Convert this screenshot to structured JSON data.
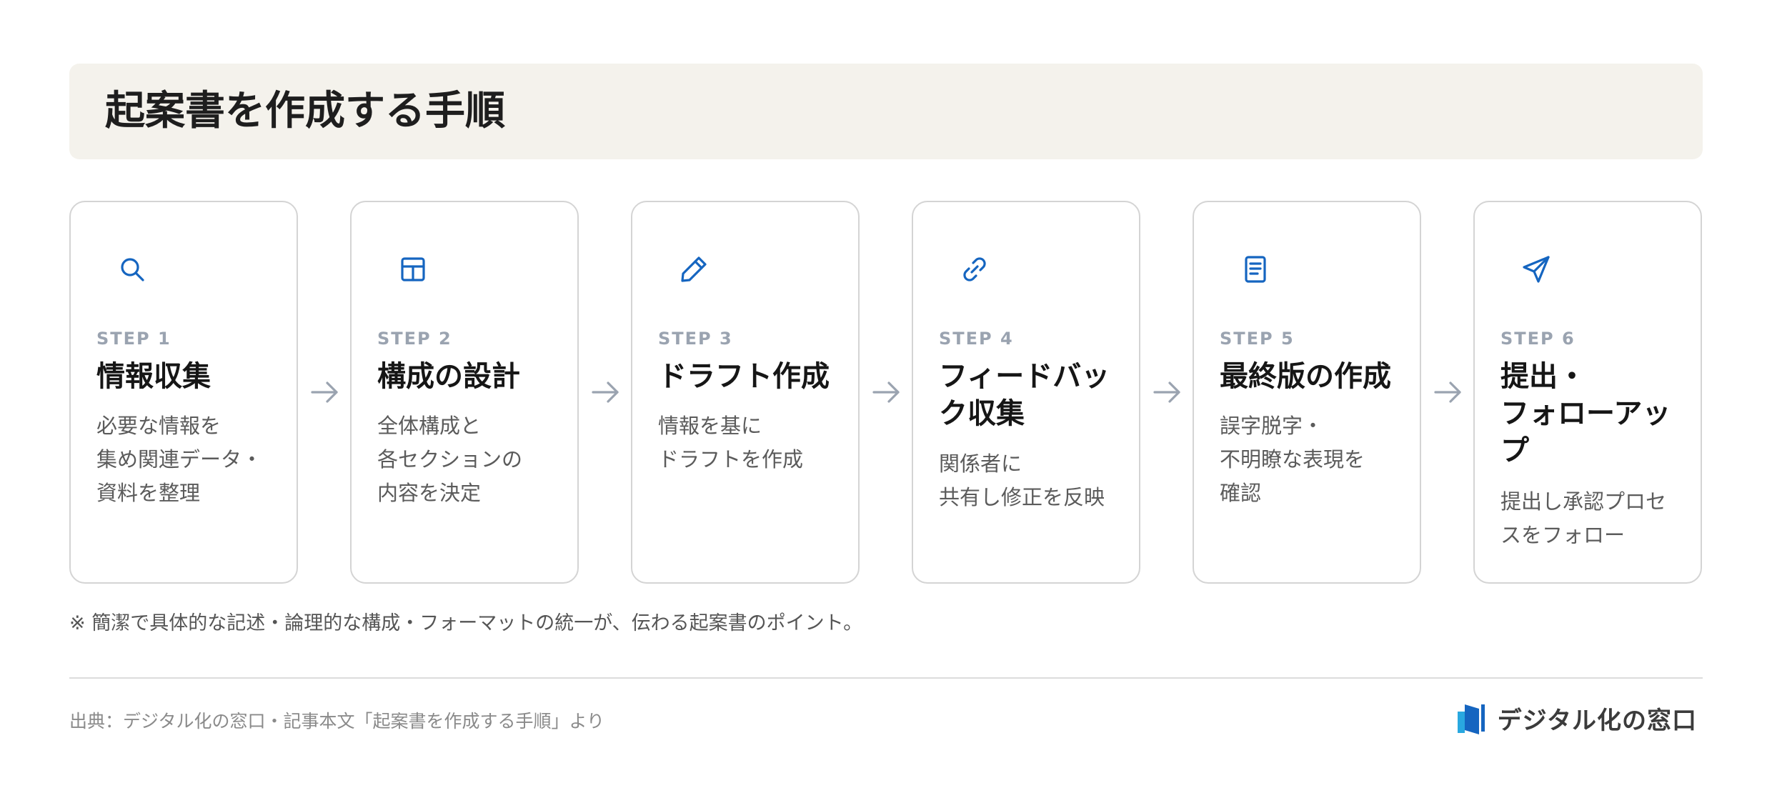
{
  "title": "起案書を作成する手順",
  "steps": [
    {
      "label": "STEP 1",
      "title": "情報収集",
      "desc": "必要な情報を\n集め関連データ・\n資料を整理",
      "icon": "search-icon"
    },
    {
      "label": "STEP 2",
      "title": "構成の設計",
      "desc": "全体構成と\n各セクションの\n内容を決定",
      "icon": "layout-icon"
    },
    {
      "label": "STEP 3",
      "title": "ドラフト作成",
      "desc": "情報を基に\nドラフトを作成",
      "icon": "pencil-icon"
    },
    {
      "label": "STEP 4",
      "title": "フィードバッ\nク収集",
      "desc": "関係者に\n共有し修正を反映",
      "icon": "link-icon"
    },
    {
      "label": "STEP 5",
      "title": "最終版の作成",
      "desc": "誤字脱字・\n不明瞭な表現を\n確認",
      "icon": "document-icon"
    },
    {
      "label": "STEP 6",
      "title": "提出・\nフォローアッ\nプ",
      "desc": "提出し承認プロセ\nスをフォロー",
      "icon": "send-icon"
    }
  ],
  "note": "※ 簡潔で具体的な記述・論理的な構成・フォーマットの統一が、伝わる起案書のポイント。",
  "source": "出典：デジタル化の窓口・記事本文「起案書を作成する手順」より",
  "brand": {
    "name": "デジタル化の窓口"
  },
  "colors": {
    "accent": "#1565c0",
    "title_band": "#f4f2ec",
    "card_border": "#d4d4d4",
    "step_label": "#9aa3b0",
    "arrow": "#9aa3b0"
  }
}
